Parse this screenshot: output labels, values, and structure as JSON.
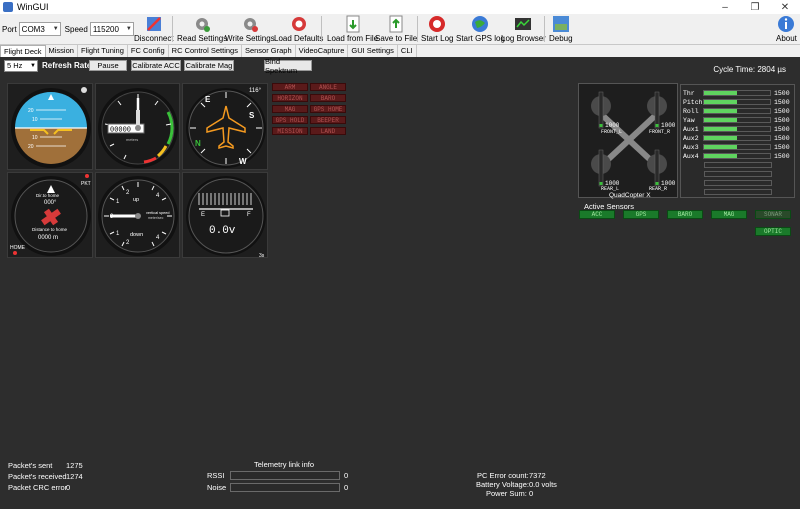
{
  "window": {
    "title": "WinGUI"
  },
  "toolbar": {
    "port_label": "Port",
    "port_value": "COM3",
    "speed_label": "Speed",
    "speed_value": "115200",
    "disconnect": "Disconnect",
    "read_settings": "Read Settings",
    "write_settings": "Write Settings",
    "load_defaults": "Load Defaults",
    "load_from_file": "Load from File",
    "save_to_file": "Save to File",
    "start_log": "Start Log",
    "start_gps_log": "Start GPS log",
    "log_browser": "Log Browser",
    "debug": "Debug",
    "about": "About"
  },
  "tabs": [
    {
      "label": "Flight Deck"
    },
    {
      "label": "Mission"
    },
    {
      "label": "Flight Tuning"
    },
    {
      "label": "FC Config"
    },
    {
      "label": "RC Control Settings"
    },
    {
      "label": "Sensor Graph"
    },
    {
      "label": "VideoCapture"
    },
    {
      "label": "GUI Settings"
    },
    {
      "label": "CLI"
    }
  ],
  "deck": {
    "refresh_rate_value": "5 Hz",
    "refresh_rate_label": "Refresh Rate",
    "pause": "Pause",
    "calibrate_acc": "Calibrate ACC",
    "calibrate_mag": "Calibrate Mag",
    "bind_spektrum": "Bind Spektrum",
    "cycle_time_label": "Cycle Time:",
    "cycle_time_value": "2804 µs"
  },
  "gauges": {
    "altimeter_digits": "00000",
    "altimeter_unit": "meters",
    "heading_value": "116°",
    "heading_letters": [
      "E",
      "S",
      "W",
      "N"
    ],
    "attitude_marks": [
      "20",
      "10",
      "10",
      "20"
    ],
    "home_pkt": "PKT",
    "home_dir_label": "Dir.to home",
    "home_dir_value": "000°",
    "home_dist_label": "Distance to home",
    "home_dist_value": "0000 m",
    "home_label": "HOME",
    "vsi_up": "up",
    "vsi_down": "down",
    "vsi_label": "vertical speed",
    "vsi_unit": "meter/sec",
    "vsi_ticks": [
      "0",
      "1",
      "2",
      "4",
      "4",
      "2",
      "1"
    ],
    "fuel_e": "E",
    "fuel_f": "F",
    "voltage": "0.0v",
    "cells": "3s",
    "airspeed_ticks": [
      "0",
      "1",
      "2",
      "3",
      "4",
      "5",
      "6",
      "7",
      "8",
      "9"
    ]
  },
  "flags": [
    "ARM",
    "ANGLE",
    "HORIZON",
    "BARO",
    "MAG",
    "GPS HOME",
    "GPS HOLD",
    "BEEPER",
    "MISSION",
    "LAND"
  ],
  "mixer": {
    "name": "QuadCopter X",
    "motors": [
      {
        "label": "FRONT_L",
        "value": "1000"
      },
      {
        "label": "FRONT_R",
        "value": "1000"
      },
      {
        "label": "REAR_L",
        "value": "1000"
      },
      {
        "label": "REAR_R",
        "value": "1000"
      }
    ]
  },
  "rc": [
    {
      "name": "Thr",
      "value": "1500",
      "level": 0.5
    },
    {
      "name": "Pitch",
      "value": "1500",
      "level": 0.5
    },
    {
      "name": "Roll",
      "value": "1500",
      "level": 0.5
    },
    {
      "name": "Yaw",
      "value": "1500",
      "level": 0.5
    },
    {
      "name": "Aux1",
      "value": "1500",
      "level": 0.5
    },
    {
      "name": "Aux2",
      "value": "1500",
      "level": 0.5
    },
    {
      "name": "Aux3",
      "value": "1500",
      "level": 0.5
    },
    {
      "name": "Aux4",
      "value": "1500",
      "level": 0.5
    }
  ],
  "sensors": {
    "title": "Active Sensors",
    "items": [
      {
        "label": "ACC",
        "active": true
      },
      {
        "label": "GPS",
        "active": true
      },
      {
        "label": "BARO",
        "active": true
      },
      {
        "label": "MAG",
        "active": true
      },
      {
        "label": "SONAR",
        "active": false
      },
      {
        "label": "OPTIC",
        "active": true
      }
    ]
  },
  "stats": {
    "packets_sent_label": "Packet's sent",
    "packets_sent_value": "1275",
    "packets_received_label": "Packet's received",
    "packets_received_value": "1274",
    "crc_label": "Packet CRC error",
    "crc_value": "0",
    "telemetry_title": "Telemetry link info",
    "rssi_label": "RSSI",
    "rssi_value": "0",
    "noise_label": "Noise",
    "noise_value": "0",
    "pc_error_label": "PC Error count:",
    "pc_error_value": "7372",
    "battery_label": "Battery Voltage:",
    "battery_value": "0.0 volts",
    "power_label": "Power Sum:",
    "power_value": "0"
  }
}
